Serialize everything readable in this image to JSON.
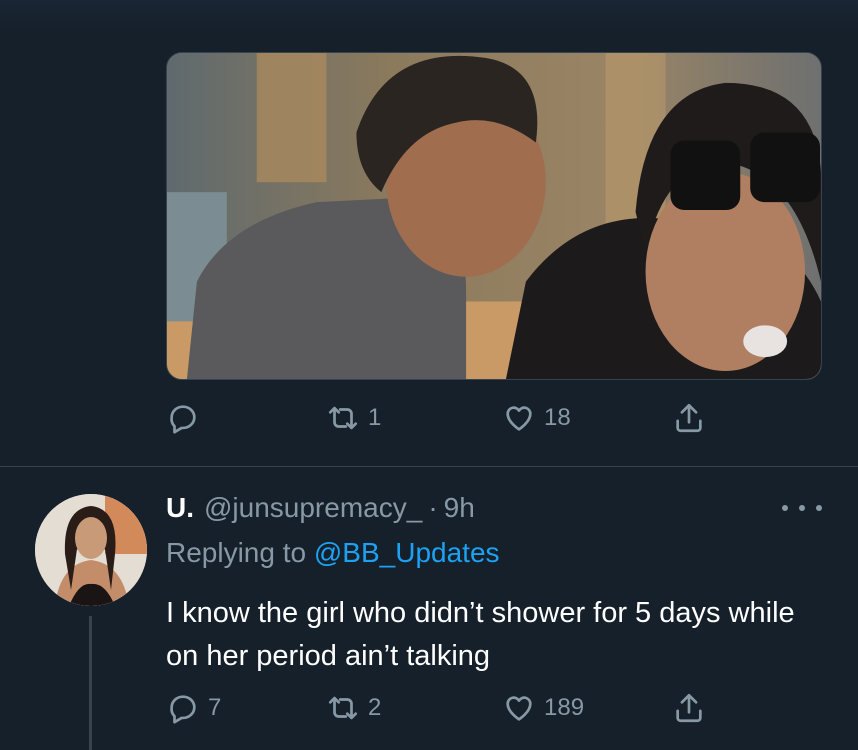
{
  "top_tweet": {
    "media_description_icon": "photo",
    "actions": {
      "reply_count": "",
      "retweet_count": "1",
      "like_count": "18"
    }
  },
  "reply_tweet": {
    "display_name": "U.",
    "handle": "@junsupremacy_",
    "separator": "·",
    "time": "9h",
    "replying_prefix": "Replying to",
    "replying_mention": "@BB_Updates",
    "text": "I know the girl who didn’t shower for 5 days while on her period ain’t talking",
    "actions": {
      "reply_count": "7",
      "retweet_count": "2",
      "like_count": "189"
    }
  },
  "colors": {
    "background": "#15202b",
    "secondary_text": "#8899a6",
    "link": "#1da1f2",
    "divider": "#38444d"
  }
}
